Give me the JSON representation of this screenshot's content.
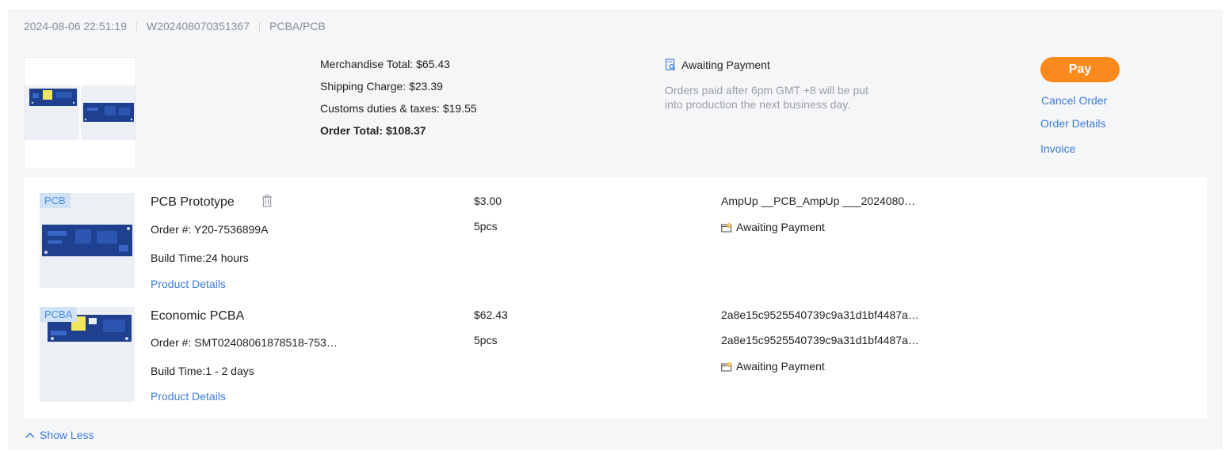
{
  "order": {
    "datetime": "2024-08-06 22:51:19",
    "order_no": "W202408070351367",
    "category": "PCBA/PCB"
  },
  "summary": {
    "merchandise_total": "Merchandise Total: $65.43",
    "shipping_charge": "Shipping Charge: $23.39",
    "customs": "Customs duties & taxes: $19.55",
    "order_total": "Order Total: $108.37"
  },
  "status": {
    "label": "Awaiting Payment",
    "icon": "document-search-icon",
    "note": "Orders paid after 6pm GMT +8 will be put into production the next business day."
  },
  "actions": {
    "pay": "Pay",
    "cancel": "Cancel Order",
    "details": "Order Details",
    "invoice": "Invoice"
  },
  "items": [
    {
      "tag": "PCB",
      "name": "PCB Prototype",
      "order_no": "Order #: Y20-7536899A",
      "build_time": "Build Time:24 hours",
      "details_link": "Product Details",
      "price": "$3.00",
      "qty": "5pcs",
      "file": "AmpUp __PCB_AmpUp ___2024080…",
      "status": "Awaiting Payment"
    },
    {
      "tag": "PCBA",
      "name": "Economic PCBA",
      "order_no": "Order #: SMT02408061878518-753…",
      "build_time": "Build Time:1 - 2 days",
      "details_link": "Product Details",
      "price": "$62.43",
      "qty": "5pcs",
      "file": "2a8e15c9525540739c9a31d1bf4487a…",
      "file2": "2a8e15c9525540739c9a31d1bf4487a…",
      "status": "Awaiting Payment"
    }
  ],
  "footer": {
    "show_less": "Show Less"
  },
  "colors": {
    "accent": "#fb8a1e",
    "link": "#3d7bd9",
    "board": "#1f3f8f"
  }
}
